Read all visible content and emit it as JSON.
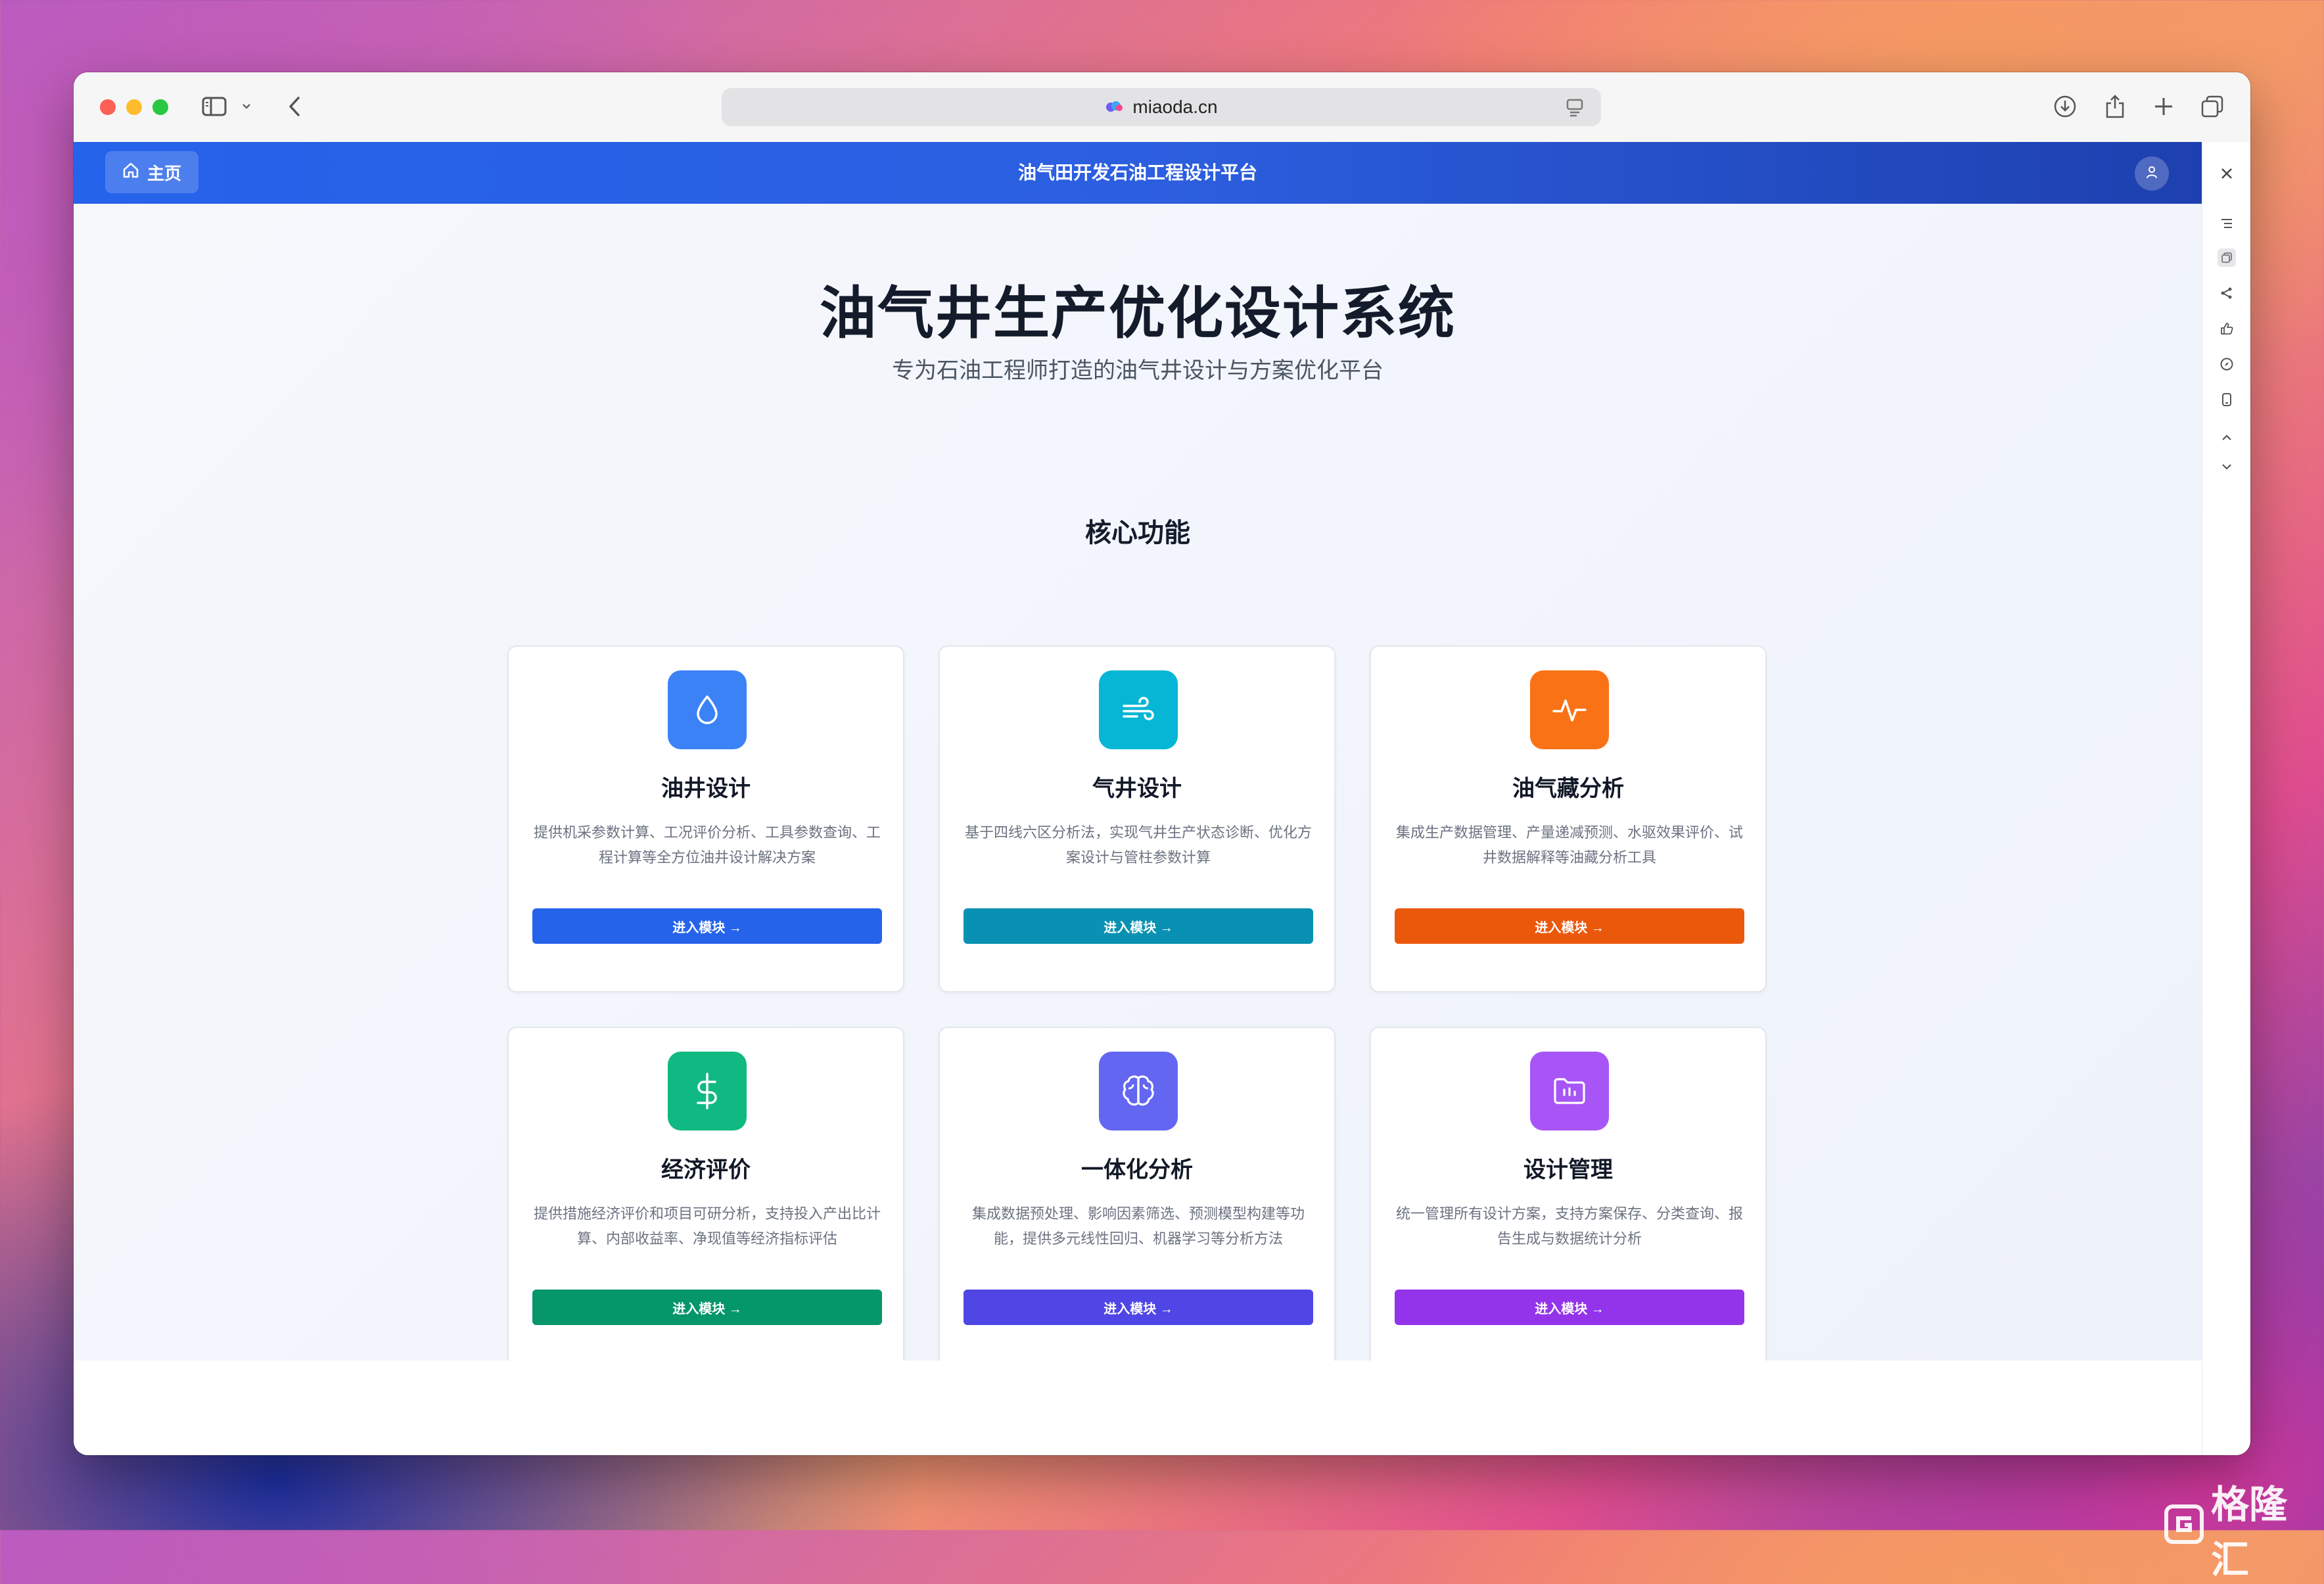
{
  "browser": {
    "url": "miaoda.cn"
  },
  "app": {
    "home_label": "主页",
    "title": "油气田开发石油工程设计平台"
  },
  "hero": {
    "title": "油气井生产优化设计系统",
    "subtitle": "专为石油工程师打造的油气井设计与方案优化平台"
  },
  "section": {
    "title": "核心功能"
  },
  "cards": [
    {
      "title": "油井设计",
      "desc": "提供机采参数计算、工况评价分析、工具参数查询、工程计算等全方位油井设计解决方案",
      "button": "进入模块 →",
      "icon": "droplet-icon",
      "icon_color": "#3b82f6",
      "button_color": "#2563eb"
    },
    {
      "title": "气井设计",
      "desc": "基于四线六区分析法，实现气井生产状态诊断、优化方案设计与管柱参数计算",
      "button": "进入模块 →",
      "icon": "wind-icon",
      "icon_color": "#06b6d4",
      "button_color": "#0891b2"
    },
    {
      "title": "油气藏分析",
      "desc": "集成生产数据管理、产量递减预测、水驱效果评价、试井数据解释等油藏分析工具",
      "button": "进入模块 →",
      "icon": "activity-icon",
      "icon_color": "#f97316",
      "button_color": "#ea580c"
    },
    {
      "title": "经济评价",
      "desc": "提供措施经济评价和项目可研分析，支持投入产出比计算、内部收益率、净现值等经济指标评估",
      "button": "进入模块 →",
      "icon": "dollar-icon",
      "icon_color": "#10b981",
      "button_color": "#059669"
    },
    {
      "title": "一体化分析",
      "desc": "集成数据预处理、影响因素筛选、预测模型构建等功能，提供多元线性回归、机器学习等分析方法",
      "button": "进入模块 →",
      "icon": "brain-icon",
      "icon_color": "#6366f1",
      "button_color": "#4f46e5"
    },
    {
      "title": "设计管理",
      "desc": "统一管理所有设计方案，支持方案保存、分类查询、报告生成与数据统计分析",
      "button": "进入模块 →",
      "icon": "folder-chart-icon",
      "icon_color": "#a855f7",
      "button_color": "#9333ea"
    }
  ],
  "watermark": {
    "text": "格隆汇"
  }
}
